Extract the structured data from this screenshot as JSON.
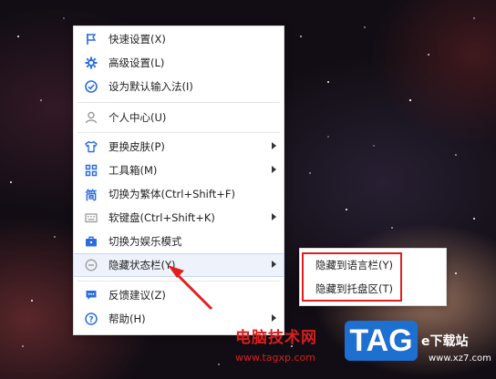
{
  "menu": {
    "items": [
      {
        "label": "快速设置(X)",
        "icon": "flag-icon",
        "submenu": false
      },
      {
        "label": "高级设置(L)",
        "icon": "gear-icon",
        "submenu": false
      },
      {
        "label": "设为默认输入法(I)",
        "icon": "check-circle-icon",
        "submenu": false
      },
      {
        "label": "个人中心(U)",
        "icon": "user-icon",
        "submenu": false
      },
      {
        "label": "更换皮肤(P)",
        "icon": "shirt-icon",
        "submenu": true
      },
      {
        "label": "工具箱(M)",
        "icon": "grid-icon",
        "submenu": true
      },
      {
        "label": "切换为繁体(Ctrl+Shift+F)",
        "icon": "traditional-char-icon",
        "icon_glyph": "简",
        "submenu": false
      },
      {
        "label": "软键盘(Ctrl+Shift+K)",
        "icon": "keyboard-icon",
        "submenu": true
      },
      {
        "label": "切换为娱乐模式",
        "icon": "briefcase-icon",
        "submenu": false
      },
      {
        "label": "隐藏状态栏(Y)",
        "icon": "minus-circle-icon",
        "submenu": true
      },
      {
        "label": "反馈建议(Z)",
        "icon": "chat-icon",
        "submenu": false
      },
      {
        "label": "帮助(H)",
        "icon": "help-icon",
        "submenu": true
      }
    ]
  },
  "submenu": {
    "items": [
      {
        "label": "隐藏到语言栏(Y)"
      },
      {
        "label": "隐藏到托盘区(T)"
      }
    ]
  },
  "watermark": {
    "site_name": "电脑技术网",
    "site_url": "www.tagxp.com",
    "tag_logo": "TAG",
    "right_text": "e下载站",
    "right_url": "www.xz7.com"
  },
  "colors": {
    "icon_blue": "#2b6de0",
    "icon_gray": "#9a9a9a",
    "highlight": "#eef2fb",
    "annotation_red": "#e21f1f"
  }
}
